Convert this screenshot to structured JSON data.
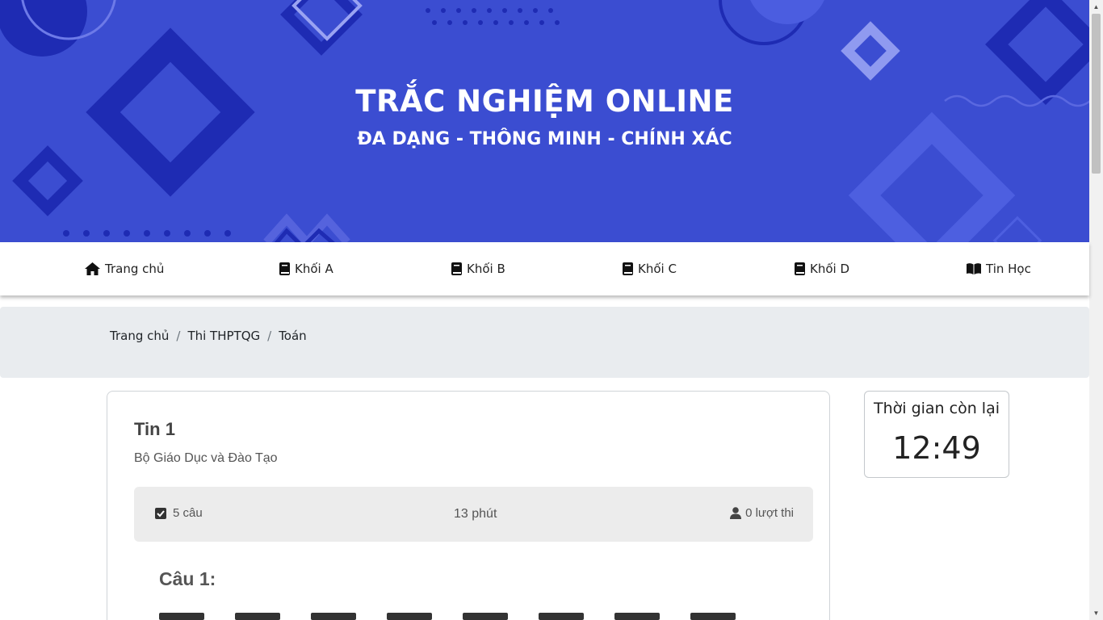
{
  "hero": {
    "title": "TRẮC NGHIỆM ONLINE",
    "subtitle": "ĐA DẠNG - THÔNG MINH - CHÍNH XÁC"
  },
  "nav": {
    "items": [
      {
        "label": "Trang chủ",
        "icon": "home-icon"
      },
      {
        "label": "Khối A",
        "icon": "book-icon"
      },
      {
        "label": "Khối B",
        "icon": "book-icon"
      },
      {
        "label": "Khối C",
        "icon": "book-icon"
      },
      {
        "label": "Khối D",
        "icon": "book-icon"
      },
      {
        "label": "Tin Học",
        "icon": "book-open-icon"
      }
    ]
  },
  "breadcrumb": {
    "items": [
      "Trang chủ",
      "Thi THPTQG",
      "Toán"
    ],
    "separator": "/"
  },
  "exam": {
    "title": "Tin 1",
    "organization": "Bộ Giáo Dục và Đào Tạo",
    "question_count": "5 câu",
    "duration": "13 phút",
    "views": "0 lượt thi",
    "question_label": "Câu 1:"
  },
  "timer": {
    "label": "Thời gian còn lại",
    "value": "12:49"
  },
  "colors": {
    "hero_bg": "#3b4dd1",
    "hero_dark": "#1e2bb3",
    "hero_light": "#7f8cf0",
    "crumb_bg": "#e9ecef",
    "info_bg": "#ececec"
  }
}
